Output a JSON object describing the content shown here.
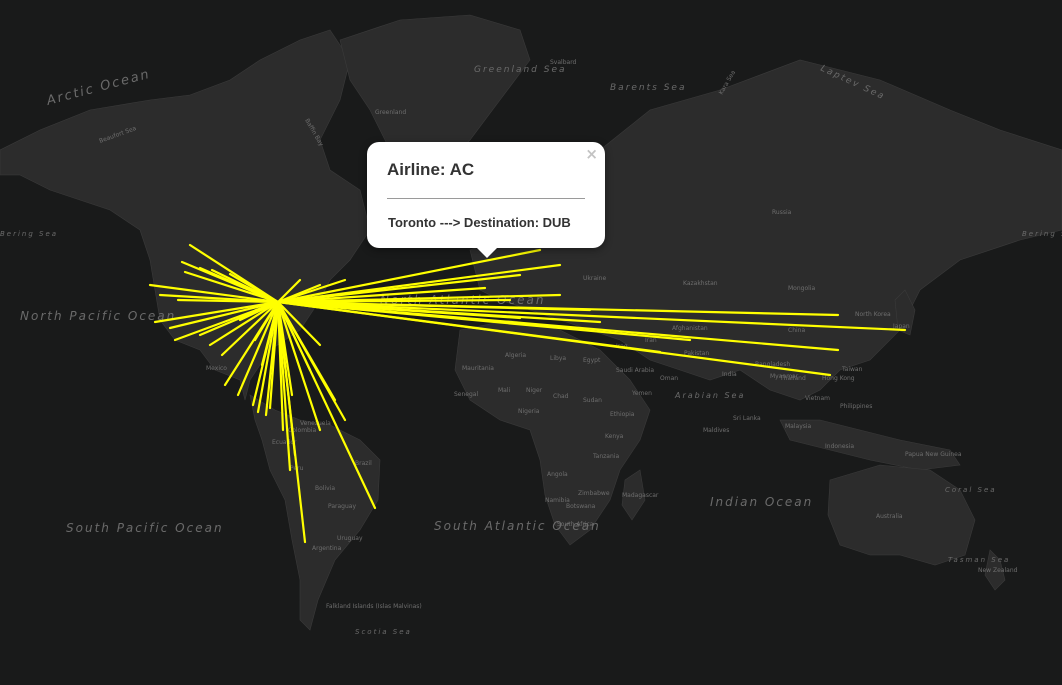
{
  "map": {
    "theme": "dark",
    "route_color": "#ffff00",
    "ocean_labels": [
      {
        "text": "Arctic Ocean"
      },
      {
        "text": "Greenland Sea"
      },
      {
        "text": "Barents Sea"
      },
      {
        "text": "Laptev Sea"
      },
      {
        "text": "North Pacific Ocean"
      },
      {
        "text": "North Atlantic Ocean"
      },
      {
        "text": "South Pacific Ocean"
      },
      {
        "text": "South Atlantic Ocean"
      },
      {
        "text": "Indian Ocean"
      },
      {
        "text": "Arabian Sea"
      },
      {
        "text": "Bering Sea"
      },
      {
        "text": "Scotia Sea"
      },
      {
        "text": "Coral Sea"
      },
      {
        "text": "Tasman Sea"
      }
    ],
    "place_labels": [
      "Greenland",
      "Russia",
      "Mongolia",
      "China",
      "India",
      "Mexico",
      "Brazil",
      "Bolivia",
      "Argentina",
      "Australia",
      "Indonesia",
      "Philippines",
      "Japan",
      "Algeria",
      "Libya",
      "Egypt",
      "Mali",
      "Niger",
      "Chad",
      "Sudan",
      "Nigeria",
      "Ethiopia",
      "Kenya",
      "Tanzania",
      "Angola",
      "Namibia",
      "Botswana",
      "Zimbabwe",
      "South Africa",
      "Madagascar",
      "Kazakhstan",
      "Iran",
      "Saudi Arabia",
      "Oman",
      "Yemen",
      "Thailand",
      "Vietnam",
      "Malaysia",
      "Sri Lanka",
      "Maldives",
      "Ukraine",
      "Mauritania",
      "Venezuela",
      "Colombia",
      "Peru",
      "Ecuador",
      "Paraguay",
      "Uruguay",
      "Papua New Guinea",
      "New Zealand",
      "Falkland Islands (Islas Malvinas)",
      "Svalbard",
      "Baffin Bay",
      "Beaufort Sea",
      "Kara Sea",
      "Senegal",
      "Iraq",
      "Afghanistan",
      "Pakistan",
      "Bangladesh",
      "Myanmar",
      "Taiwan",
      "North Korea",
      "Hong Kong"
    ]
  },
  "popup": {
    "title": "Airline: AC",
    "route_text": "Toronto ---> Destination: DUB",
    "close_symbol": "×"
  }
}
